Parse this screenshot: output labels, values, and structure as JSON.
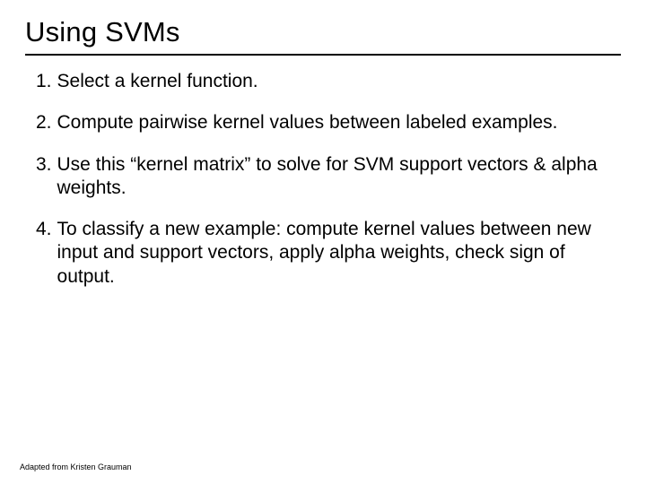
{
  "title": "Using SVMs",
  "items": [
    {
      "num": "1.",
      "text": "Select a kernel function."
    },
    {
      "num": "2.",
      "text": "Compute pairwise kernel values between labeled examples."
    },
    {
      "num": "3.",
      "text": "Use this “kernel matrix” to solve for SVM support vectors & alpha weights."
    },
    {
      "num": "4.",
      "text": "To classify a new example: compute kernel values between new input and support vectors, apply alpha weights, check sign of output."
    }
  ],
  "attribution": "Adapted from Kristen Grauman"
}
